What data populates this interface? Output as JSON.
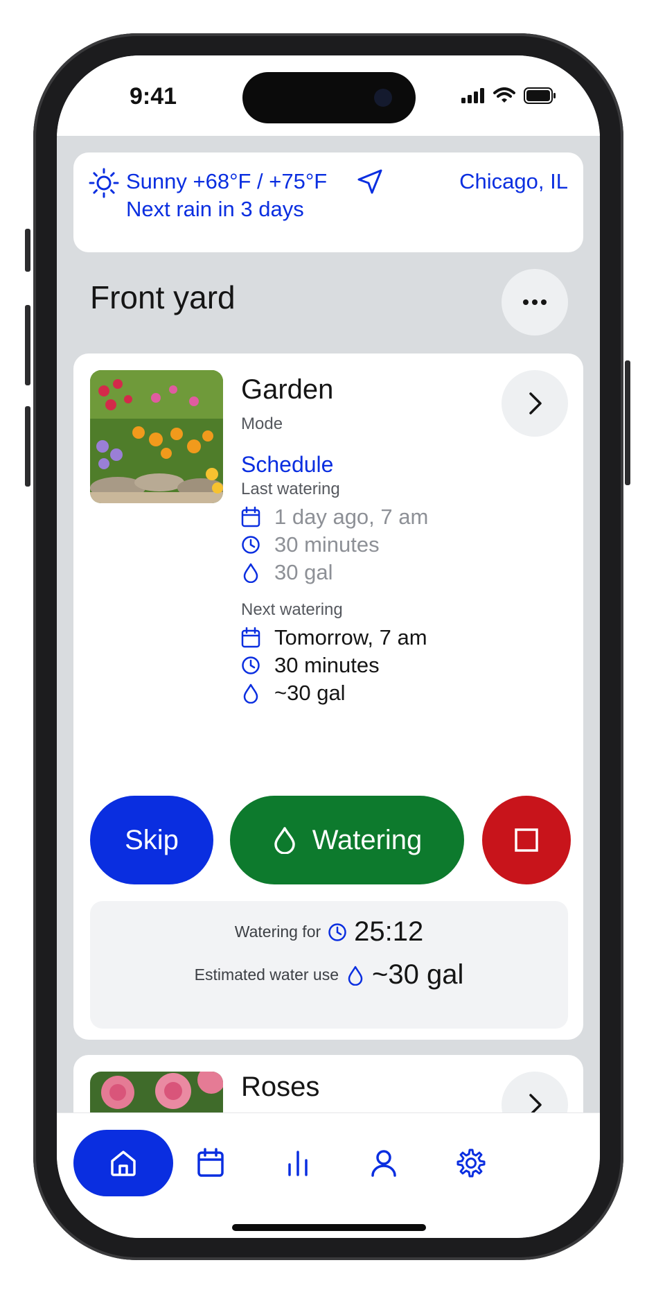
{
  "status_bar": {
    "time": "9:41"
  },
  "weather": {
    "condition_temp": "Sunny +68°F / +75°F",
    "next_rain": "Next rain in 3 days",
    "location": "Chicago, IL"
  },
  "section": {
    "title": "Front yard"
  },
  "zone": {
    "name": "Garden",
    "mode_label": "Mode",
    "mode_value": "Schedule",
    "last_label": "Last watering",
    "last": {
      "date": "1 day ago, 7 am",
      "duration": "30 minutes",
      "volume": "30 gal"
    },
    "next_label": "Next watering",
    "next": {
      "date": "Tomorrow, 7 am",
      "duration": "30 minutes",
      "volume": "~30 gal"
    },
    "skip_label": "Skip",
    "watering_label": "Watering",
    "watering_for_label": "Watering for",
    "watering_for_value": "25:12",
    "estimate_label": "Estimated water use",
    "estimate_value": "~30 gal"
  },
  "zone2": {
    "name": "Roses"
  },
  "colors": {
    "accent": "#0a2ee0",
    "watering": "#0d7a2d",
    "stop": "#c8141b"
  },
  "nav": {
    "items": [
      {
        "icon": "home-icon",
        "active": true
      },
      {
        "icon": "calendar-icon",
        "active": false
      },
      {
        "icon": "stats-icon",
        "active": false
      },
      {
        "icon": "profile-icon",
        "active": false
      },
      {
        "icon": "settings-icon",
        "active": false
      }
    ]
  }
}
